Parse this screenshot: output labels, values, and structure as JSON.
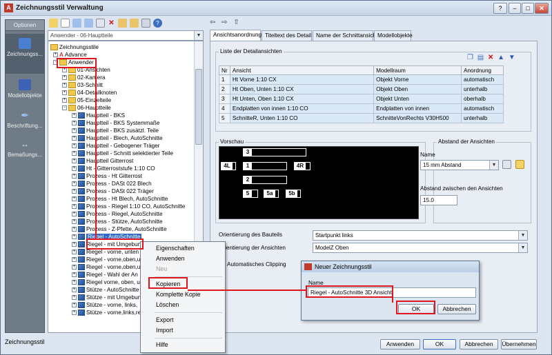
{
  "window": {
    "title": "Zeichnungsstil Verwaltung",
    "app_icon": "A",
    "controls": [
      "?",
      "–",
      "□",
      "✕"
    ]
  },
  "left_panel": {
    "options_label": "Optionen",
    "items": [
      {
        "label": "Zeichnungss...",
        "icon": "drawing-style-icon"
      },
      {
        "label": "Modellobjekte",
        "icon": "model-objects-icon"
      },
      {
        "label": "Beschriftung...",
        "icon": "annotation-icon"
      },
      {
        "label": "Bemaßungs...",
        "icon": "dimension-icon"
      }
    ]
  },
  "toolbar": {
    "style_combo_value": "Anwender - 06-Hauptteile",
    "nav": [
      "⇦",
      "⇨",
      "⇧"
    ]
  },
  "tree": {
    "root": "Zeichnungsstile",
    "advance": "Advance",
    "anwender": "Anwender",
    "groups": [
      "01-Ansichten",
      "02-Kamera",
      "03-Schnitt",
      "04-Detailknoten",
      "05-Einzelteile",
      "06-Hauptteile"
    ],
    "items": [
      "Hauptteil - BKS",
      "Hauptteil - BKS Systemmaße",
      "Hauptteil - BKS zusätzl. Teile",
      "Hauptteil - Blech, AutoSchnitte",
      "Hauptteil - Gebogener Träger",
      "Hauptteil - Schnitt selektierter Teile",
      "Hauptteil Gitterrost",
      "Ht - Gitterroststufe 1:10 CO",
      "Prozess - Ht Gitterrost",
      "Prozess - DASt 022 Blech",
      "Prozess - DASt 022 Träger",
      "Prozess - Ht Blech, AutoSchnitte",
      "Prozess - Riegel 1:10 CO, AutoSchnitte",
      "Prozess - Riegel, AutoSchnitte",
      "Prozess - Stütze, AutoSchnitte",
      "Prozess - Z-Pfette, AutoSchnitte",
      "Riegel - AutoSchnitte",
      "Riegel - mit Umgebun",
      "Riegel - vorne, unten -",
      "Riegel - vorne,oben,u",
      "Riegel - vorne,oben,u",
      "Riegel - Wahl der An",
      "Riegel vorne, oben, u",
      "Stütze - AutoSchnitte",
      "Stütze - mit Umgebun",
      "Stütze - vorne, links,",
      "Stütze - vorne,links,re"
    ]
  },
  "tabs": [
    "Ansichtsanordnung",
    "Titeltext des Detail",
    "Name der Schnittansicht",
    "Modellobjekte"
  ],
  "detail_views": {
    "group_label": "Liste der Detailansichten",
    "columns": [
      "Nr",
      "Ansicht",
      "Modellraum",
      "Anordnung"
    ],
    "rows": [
      [
        "1",
        "Ht Vorne 1:10 CX",
        "Objekt Vorne",
        "automatisch"
      ],
      [
        "2",
        "Ht Oben, Unten 1:10 CX",
        "Objekt Oben",
        "unterhalb"
      ],
      [
        "3",
        "Ht Unten, Oben 1:10 CX",
        "Objekt Unten",
        "oberhalb"
      ],
      [
        "4",
        "Endplatten von innen 1:10 CO",
        "Endplatten von innen",
        "automatisch"
      ],
      [
        "5",
        "SchnitteR, Unten 1:10 CO",
        "SchnitteVonRechts V30H500",
        "unterhalb"
      ]
    ]
  },
  "preview": {
    "label": "Vorschau",
    "boxes": [
      "3",
      "4L",
      "1",
      "4R",
      "2",
      "5",
      "5a",
      "5b"
    ]
  },
  "spacing": {
    "group_label": "Abstand der Ansichten",
    "name_label": "Name",
    "name_value": "15 mm Abstand",
    "between_label": "Abstand zwischen den Ansichten",
    "between_value": "15.0"
  },
  "orientation": {
    "part_label": "Orientierung des Bauteils",
    "part_value": "Startpunkt links",
    "views_label": "Orientierung der Ansichten",
    "views_value": "ModelZ Oben",
    "clipping_label": "Automatisches Clipping"
  },
  "context_menu": {
    "items": [
      "Eigenschaften",
      "Anwenden",
      "Neu",
      "Kopieren",
      "Komplette Kopie",
      "Löschen",
      "Export",
      "Import",
      "Hilfe"
    ]
  },
  "dialog": {
    "title": "Neuer Zeichnungsstil",
    "name_label": "Name",
    "name_value": "Riegel - AutoSchnitte 3D Ansicht",
    "ok": "OK",
    "cancel": "Abbrechen"
  },
  "footer": {
    "status": "Zeichnungsstil",
    "buttons": [
      "Anwenden",
      "OK",
      "Abbrechen",
      "Übernehmen"
    ]
  },
  "colors": {
    "highlight": "#e0141c",
    "selection": "#3169c6"
  }
}
